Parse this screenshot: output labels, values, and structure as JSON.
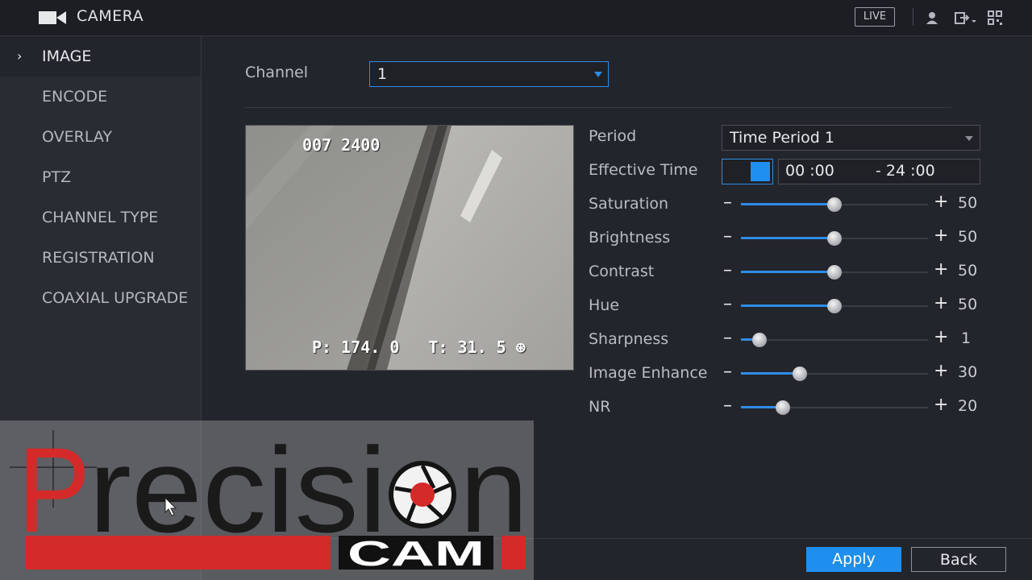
{
  "header": {
    "title": "CAMERA",
    "live_label": "LIVE"
  },
  "sidebar": {
    "items": [
      {
        "label": "IMAGE",
        "active": true
      },
      {
        "label": "ENCODE"
      },
      {
        "label": "OVERLAY"
      },
      {
        "label": "PTZ"
      },
      {
        "label": "CHANNEL TYPE"
      },
      {
        "label": "REGISTRATION"
      },
      {
        "label": "COAXIAL UPGRADE"
      }
    ]
  },
  "main": {
    "channel_label": "Channel",
    "channel_value": "1",
    "preview": {
      "osd_top": "007 2400",
      "osd_bottom": "P: 174. 0   T: 31. 5 ⊛"
    },
    "period_label": "Period",
    "period_value": "Time Period 1",
    "effective_time_label": "Effective Time",
    "time_start": "00 :00",
    "time_end": "- 24 :00",
    "sliders": [
      {
        "label": "Saturation",
        "value": 50,
        "max": 100
      },
      {
        "label": "Brightness",
        "value": 50,
        "max": 100
      },
      {
        "label": "Contrast",
        "value": 50,
        "max": 100
      },
      {
        "label": "Hue",
        "value": 50,
        "max": 100
      },
      {
        "label": "Sharpness",
        "value": 1,
        "max": 15
      },
      {
        "label": "Image Enhance",
        "value": 30,
        "max": 100
      },
      {
        "label": "NR",
        "value": 20,
        "max": 100
      }
    ],
    "minus_symbol": "–",
    "plus_symbol": "+"
  },
  "footer": {
    "apply_label": "Apply",
    "back_label": "Back"
  },
  "watermark": {
    "text_top": "Precision",
    "text_bottom": "CAM"
  },
  "colors": {
    "accent": "#1f8fef",
    "logo_red": "#d42a2a"
  }
}
